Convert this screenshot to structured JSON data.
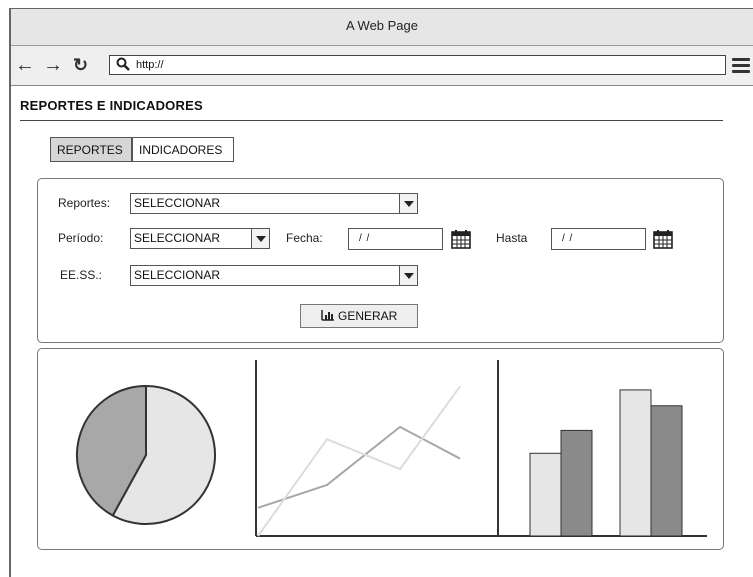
{
  "window": {
    "title": "A Web Page"
  },
  "browser": {
    "url": "http://",
    "icons": {
      "back": "arrow-left-icon",
      "forward": "arrow-right-icon",
      "reload": "reload-icon",
      "search": "search-icon",
      "menu": "hamburger-menu-icon"
    }
  },
  "page": {
    "heading": "REPORTES E INDICADORES",
    "tabs": [
      {
        "label": "REPORTES",
        "selected": true
      },
      {
        "label": "INDICADORES",
        "selected": false
      }
    ]
  },
  "form": {
    "reportes_label": "Reportes:",
    "reportes_value": "SELECCIONAR",
    "periodo_label": "Período:",
    "periodo_value": "SELECCIONAR",
    "fecha_label": "Fecha:",
    "fecha_value": "/ /",
    "hasta_label": "Hasta",
    "hasta_value": "/ /",
    "eess_label": "EE.SS.:",
    "eess_value": "SELECCIONAR",
    "generate_label": "GENERAR",
    "generate_icon": "bar-chart-icon",
    "calendar_icon": "calendar-icon"
  },
  "charts": {
    "colors": {
      "light": "#e6e6e6",
      "medium": "#a8a8a8",
      "dark": "#8a8a8a",
      "outline": "#333333"
    },
    "pie": {
      "slices": [
        0.58,
        0.42
      ]
    },
    "line": {
      "series": [
        [
          0.16,
          0.29,
          0.62,
          0.44
        ],
        [
          0.0,
          0.55,
          0.38,
          0.85
        ]
      ]
    },
    "bar": {
      "groups": [
        [
          0.47,
          0.6
        ],
        [
          0.83,
          0.74
        ]
      ]
    }
  }
}
